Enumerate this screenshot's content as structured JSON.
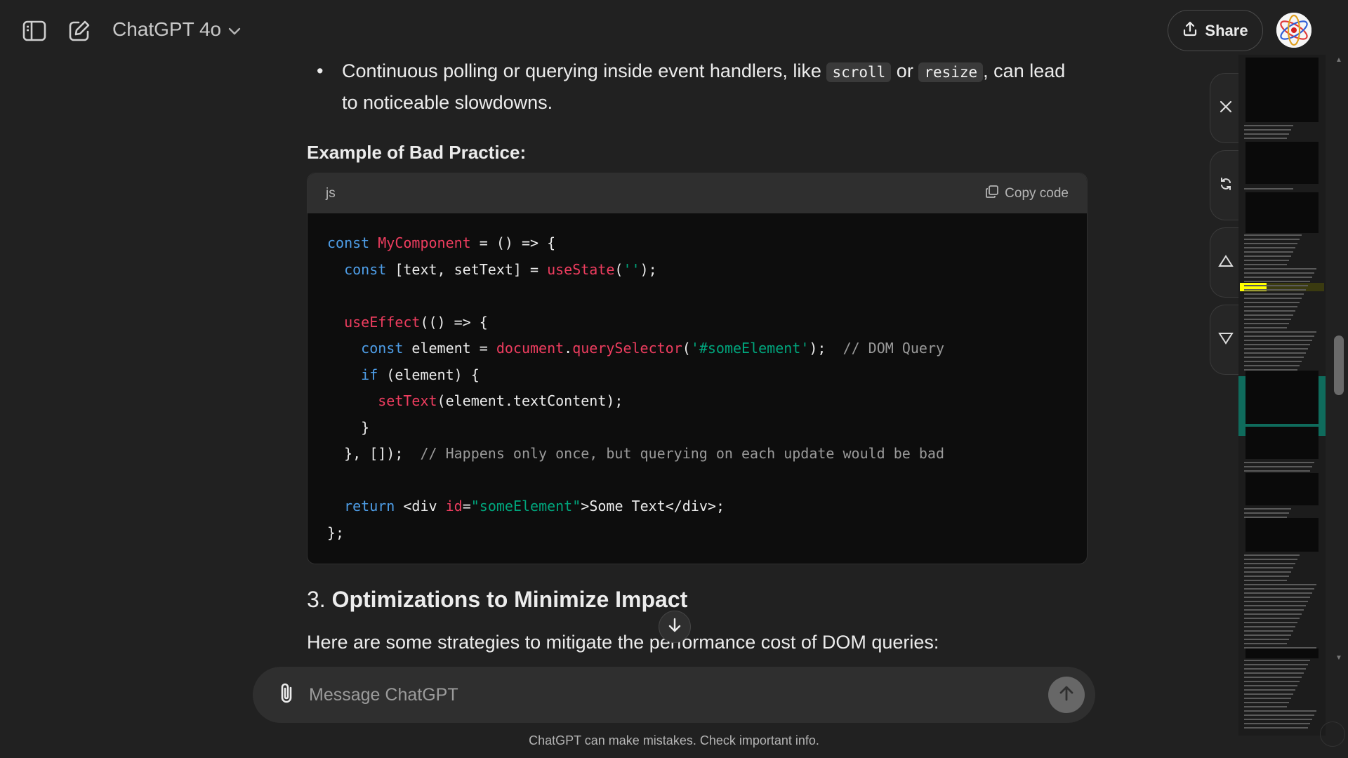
{
  "header": {
    "model_label": "ChatGPT 4o",
    "share_label": "Share"
  },
  "message": {
    "bullet_text_before": "Continuous polling or querying inside event handlers, like ",
    "bullet_code_1": "scroll",
    "bullet_text_mid": " or ",
    "bullet_code_2": "resize",
    "bullet_text_after": ", can lead to noticeable slowdowns.",
    "subheading": "Example of Bad Practice:",
    "code_block": {
      "language": "js",
      "copy_label": "Copy code",
      "lines": [
        [
          {
            "t": "const ",
            "c": "kw"
          },
          {
            "t": "MyComponent",
            "c": "fn"
          },
          {
            "t": " = () => {",
            "c": ""
          }
        ],
        [
          {
            "t": "  ",
            "c": ""
          },
          {
            "t": "const",
            "c": "kw"
          },
          {
            "t": " [text, setText] = ",
            "c": ""
          },
          {
            "t": "useState",
            "c": "fn"
          },
          {
            "t": "(",
            "c": ""
          },
          {
            "t": "''",
            "c": "str"
          },
          {
            "t": ");",
            "c": ""
          }
        ],
        [],
        [
          {
            "t": "  ",
            "c": ""
          },
          {
            "t": "useEffect",
            "c": "fn"
          },
          {
            "t": "(() => {",
            "c": ""
          }
        ],
        [
          {
            "t": "    ",
            "c": ""
          },
          {
            "t": "const",
            "c": "kw"
          },
          {
            "t": " element = ",
            "c": ""
          },
          {
            "t": "document",
            "c": "fn"
          },
          {
            "t": ".",
            "c": ""
          },
          {
            "t": "querySelector",
            "c": "fn"
          },
          {
            "t": "(",
            "c": ""
          },
          {
            "t": "'#someElement'",
            "c": "str"
          },
          {
            "t": ");  ",
            "c": ""
          },
          {
            "t": "// DOM Query",
            "c": "cm"
          }
        ],
        [
          {
            "t": "    ",
            "c": ""
          },
          {
            "t": "if",
            "c": "kw"
          },
          {
            "t": " (element) {",
            "c": ""
          }
        ],
        [
          {
            "t": "      ",
            "c": ""
          },
          {
            "t": "setText",
            "c": "fn"
          },
          {
            "t": "(element.textContent);",
            "c": ""
          }
        ],
        [
          {
            "t": "    }",
            "c": ""
          }
        ],
        [
          {
            "t": "  }, []);  ",
            "c": ""
          },
          {
            "t": "// Happens only once, but querying on each update would be bad",
            "c": "cm"
          }
        ],
        [],
        [
          {
            "t": "  ",
            "c": ""
          },
          {
            "t": "return",
            "c": "kw"
          },
          {
            "t": " <div ",
            "c": ""
          },
          {
            "t": "id",
            "c": "fn"
          },
          {
            "t": "=",
            "c": ""
          },
          {
            "t": "\"someElement\"",
            "c": "str"
          },
          {
            "t": ">Some Text</div>;",
            "c": ""
          }
        ],
        [
          {
            "t": "};",
            "c": ""
          }
        ]
      ]
    },
    "section_number": "3.",
    "section_title": "Optimizations to Minimize Impact",
    "section_paragraph": "Here are some strategies to mitigate the performance cost of DOM queries:"
  },
  "composer": {
    "placeholder": "Message ChatGPT"
  },
  "footer": {
    "disclaimer": "ChatGPT can make mistakes. Check important info."
  },
  "icons": {
    "sidebar_toggle": "sidebar-toggle-icon",
    "new_chat": "new-chat-icon",
    "chevron": "chevron-down-icon",
    "share": "share-upload-icon",
    "copy": "copy-icon",
    "attach": "paperclip-icon",
    "send": "arrow-up-icon",
    "scroll_down": "arrow-down-icon",
    "close": "close-icon",
    "refresh": "refresh-icon",
    "prev": "triangle-up-icon",
    "next": "triangle-down-icon"
  },
  "colors": {
    "background": "#212121",
    "code_keyword": "#4e9ee8",
    "code_function": "#ee3d5f",
    "code_string": "#00a67d",
    "code_comment": "#9a9a9a",
    "highlight_yellow": "#ffff00",
    "highlight_teal": "#0f6b5c"
  }
}
